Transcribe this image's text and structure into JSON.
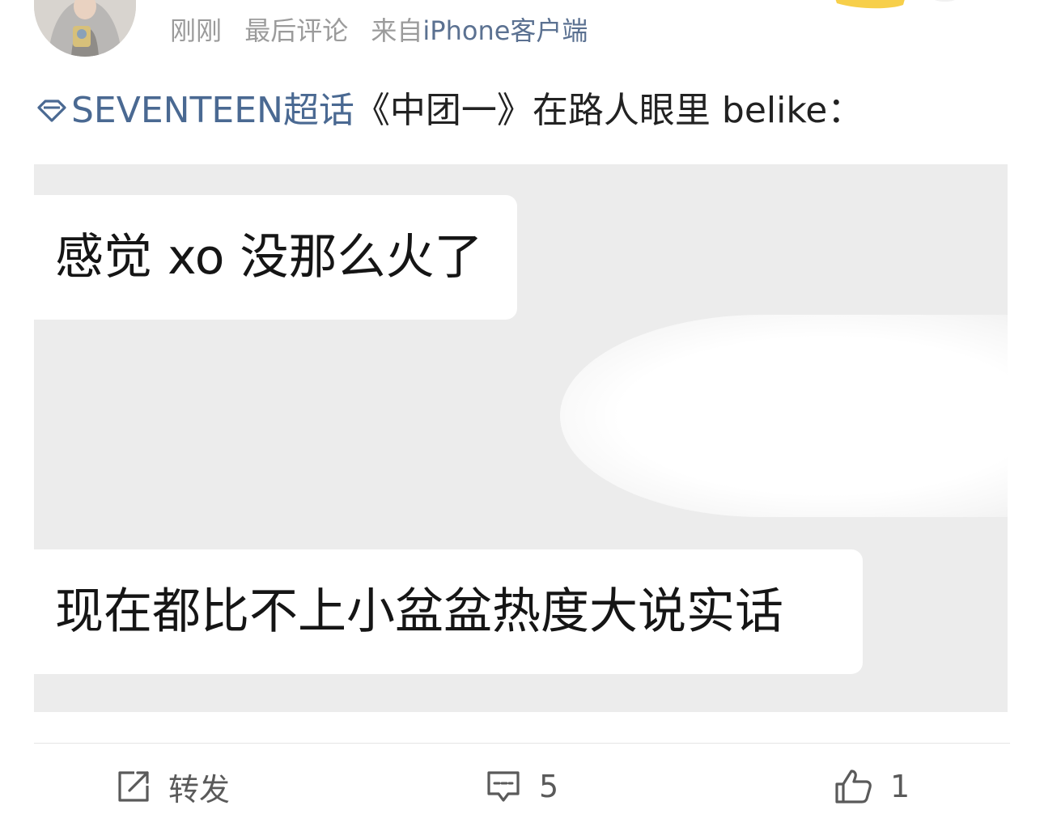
{
  "header": {
    "avatar_icon": "user-avatar-icon",
    "time": "刚刚",
    "last_action": "最后评论",
    "source_prefix": "来自",
    "source_client": "iPhone客户端"
  },
  "post": {
    "topic_icon": "diamond-icon",
    "topic": "SEVENTEEN超话",
    "text": "《中团一》在路人眼里 belike："
  },
  "image": {
    "message_1": "感觉 xo 没那么火了",
    "message_2": "现在都比不上小盆盆热度大说实话"
  },
  "actions": {
    "repost_icon": "share-icon",
    "repost_label": "转发",
    "comment_icon": "comment-icon",
    "comment_count": "5",
    "like_icon": "thumbs-up-icon",
    "like_count": "1"
  },
  "colors": {
    "topic_link": "#4a6992",
    "meta_text": "#9b9b9b",
    "image_bg": "#ececec",
    "action_text": "#5a5a5a"
  }
}
